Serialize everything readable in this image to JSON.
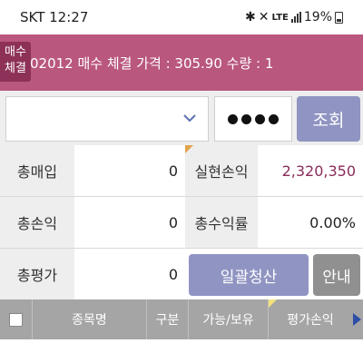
{
  "status_bar": {
    "carrier": "SKT",
    "time": "12:27",
    "network_label": "LTE",
    "battery": "19%"
  },
  "notice": {
    "badge_line1": "매수",
    "badge_line2": "체결",
    "message": "02012 매수 체결 가격 : 305.90 수량 : 1"
  },
  "search": {
    "account_value": "",
    "password_masked": "●●●●",
    "query_button": "조회"
  },
  "summary": {
    "total_purchase_label": "총매입",
    "total_purchase_value": "0",
    "realized_pl_label": "실현손익",
    "realized_pl_value": "2,320,350",
    "total_pl_label": "총손익",
    "total_pl_value": "0",
    "total_return_label": "총수익률",
    "total_return_value": "0.00%",
    "total_valuation_label": "총평가",
    "total_valuation_value": "0",
    "liquidate_all_button": "일괄청산",
    "guide_button": "안내"
  },
  "table": {
    "columns": [
      "종목명",
      "구분",
      "가능/보유",
      "평가손익"
    ]
  },
  "colors": {
    "notice_bg": "#b9577f",
    "badge_bg": "#8e3158",
    "button_primary": "#8f94c2",
    "button_secondary": "#909090",
    "realized_pl_text": "#8a2b5b",
    "header_bg": "#a5a5a5"
  }
}
